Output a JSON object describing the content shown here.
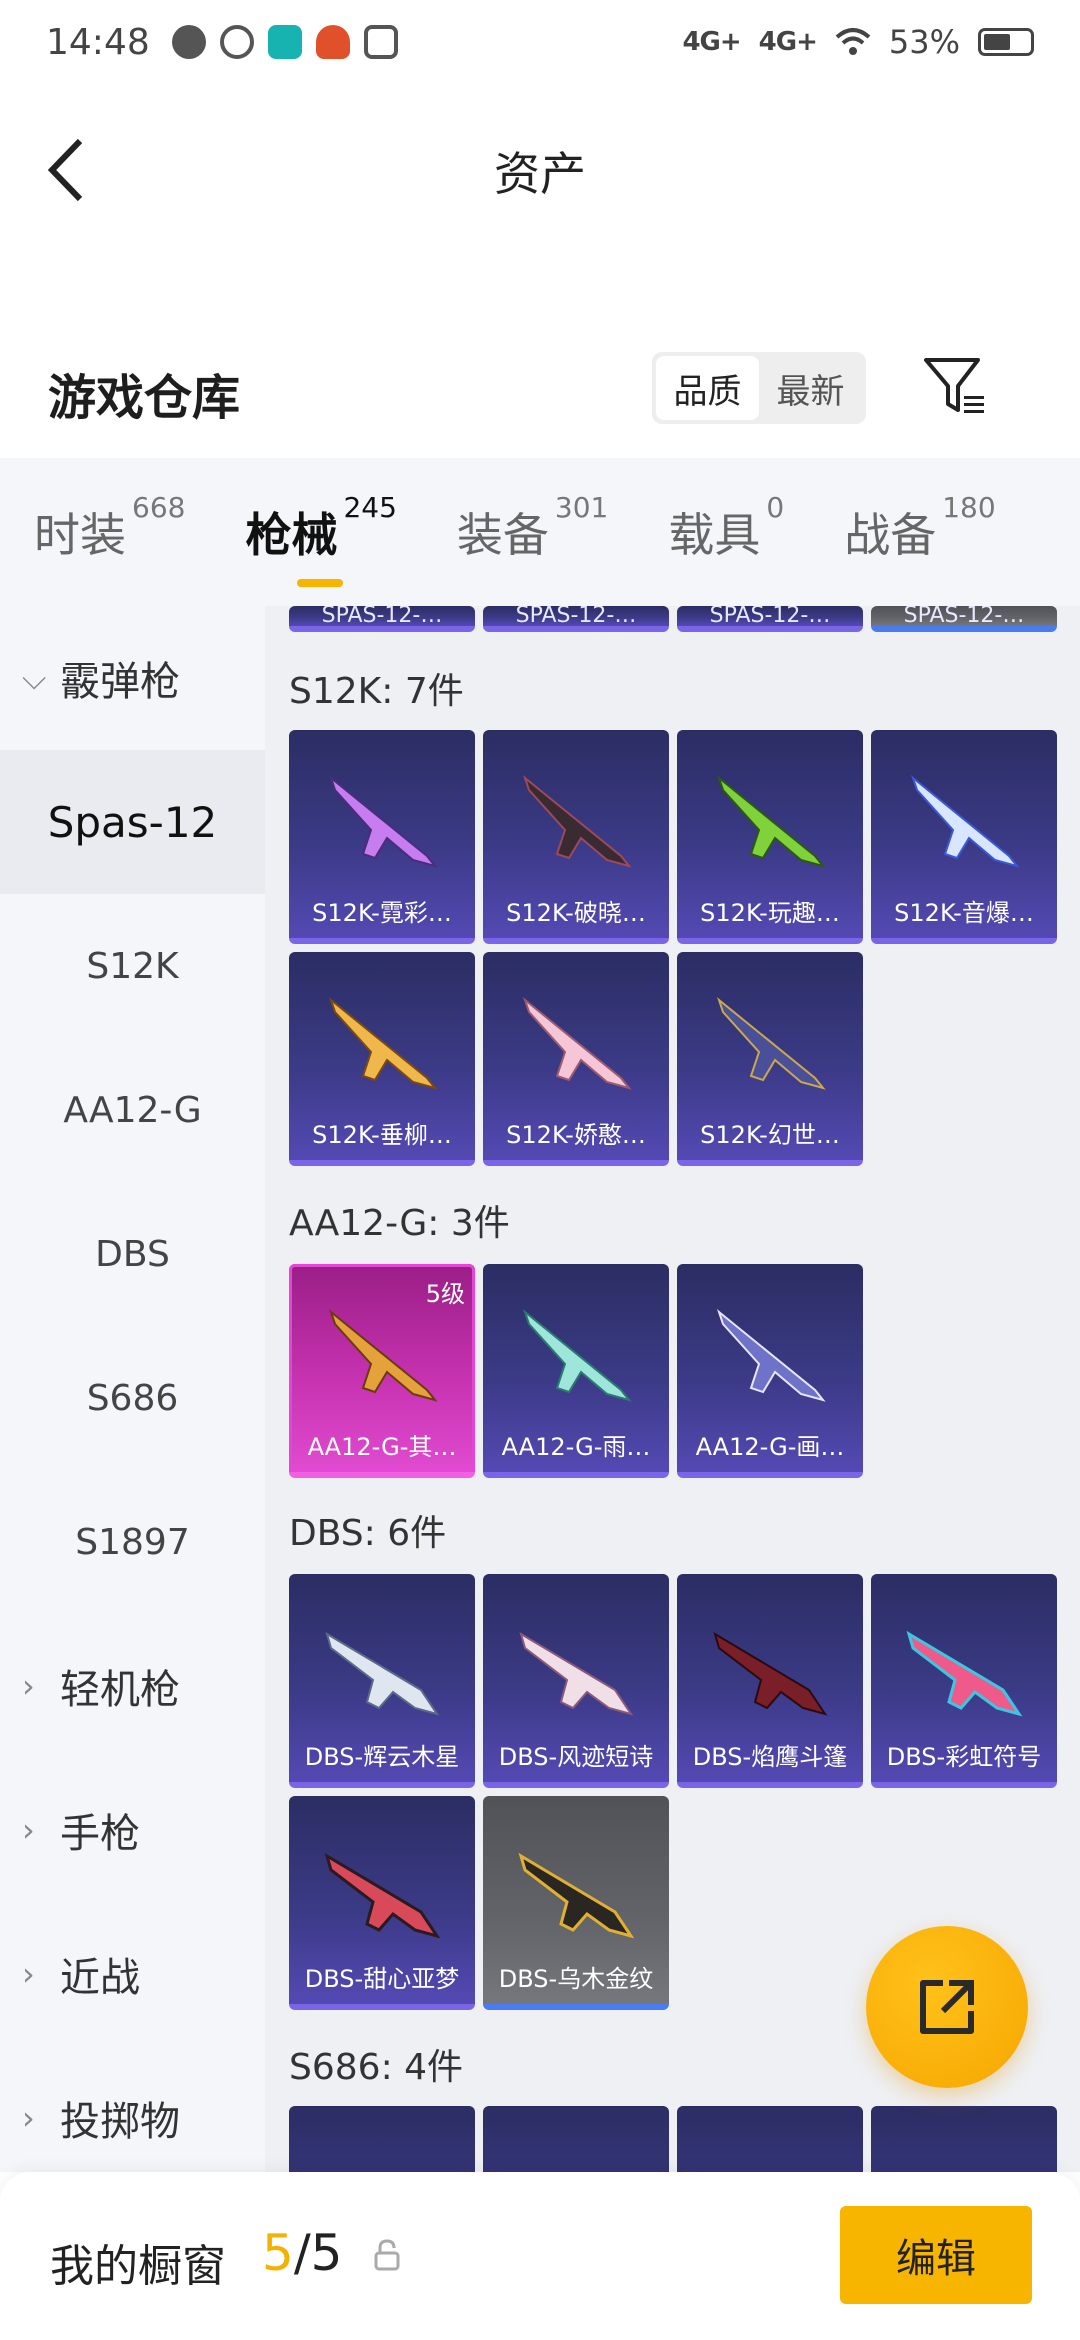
{
  "status_bar": {
    "time": "14:48",
    "net1": "4G+",
    "net2": "4G+",
    "battery": "53%"
  },
  "header": {
    "title": "资产"
  },
  "warehouse": {
    "title": "游戏仓库",
    "sort_quality": "品质",
    "sort_latest": "最新"
  },
  "tabs": [
    {
      "label": "时装",
      "count": "668"
    },
    {
      "label": "枪械",
      "count": "245"
    },
    {
      "label": "装备",
      "count": "301"
    },
    {
      "label": "载具",
      "count": "0"
    },
    {
      "label": "战备",
      "count": "180"
    }
  ],
  "sidebar": {
    "shotgun_group": "霰弹枪",
    "items": [
      "Spas-12",
      "S12K",
      "AA12-G",
      "DBS",
      "S686",
      "S1897"
    ],
    "lmg_group": "轻机枪",
    "pistol_group": "手枪",
    "melee_group": "近战",
    "throwable_group": "投掷物"
  },
  "content": {
    "spas_stubs": [
      "SPAS-12-…",
      "SPAS-12-…",
      "SPAS-12-…",
      "SPAS-12-…"
    ],
    "s12k_title": "S12K: 7件",
    "s12k_items": [
      "S12K-霓彩…",
      "S12K-破晓…",
      "S12K-玩趣…",
      "S12K-音爆…",
      "S12K-垂柳…",
      "S12K-娇憨…",
      "S12K-幻世…"
    ],
    "aa12_title": "AA12-G: 3件",
    "aa12_items": [
      "AA12-G-其…",
      "AA12-G-雨…",
      "AA12-G-画…"
    ],
    "aa12_level": "5级",
    "dbs_title": "DBS: 6件",
    "dbs_items": [
      "DBS-辉云木星",
      "DBS-风迹短诗",
      "DBS-焰鹰斗篷",
      "DBS-彩虹符号",
      "DBS-甜心亚梦",
      "DBS-乌木金纹"
    ],
    "s686_title": "S686: 4件"
  },
  "bottom": {
    "label": "我的橱窗",
    "count_current": "5",
    "count_sep": "/",
    "count_max": "5",
    "edit": "编辑"
  },
  "colors": {
    "accent": "#f7b500",
    "card_purple": "#3b3a86",
    "card_pink": "#c632b0",
    "card_gray": "#62646a"
  }
}
